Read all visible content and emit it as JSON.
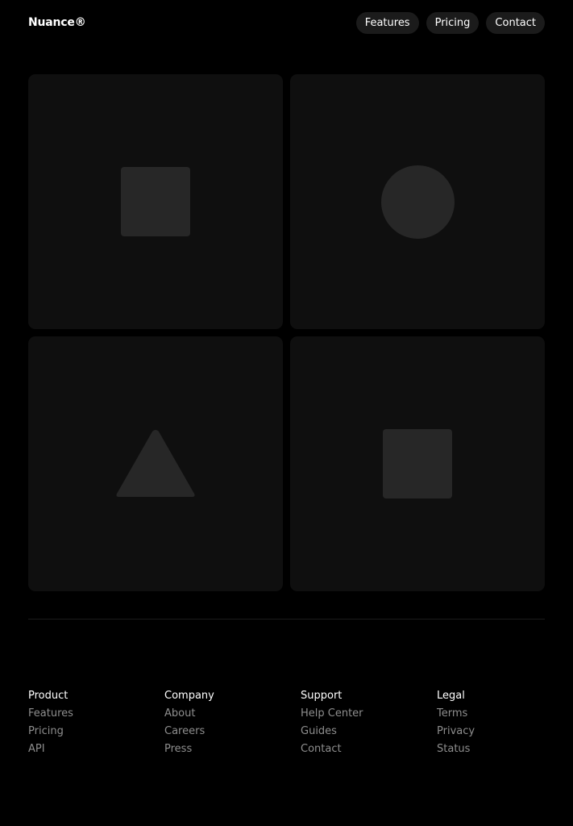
{
  "header": {
    "logo": "Nuance®",
    "nav": [
      {
        "label": "Features"
      },
      {
        "label": "Pricing"
      },
      {
        "label": "Contact"
      }
    ]
  },
  "tiles": [
    {
      "shape": "square-icon"
    },
    {
      "shape": "circle-icon"
    },
    {
      "shape": "triangle-icon"
    },
    {
      "shape": "square-icon"
    }
  ],
  "footer": {
    "columns": [
      {
        "heading": "Product",
        "links": [
          "Features",
          "Pricing",
          "API"
        ]
      },
      {
        "heading": "Company",
        "links": [
          "About",
          "Careers",
          "Press"
        ]
      },
      {
        "heading": "Support",
        "links": [
          "Help Center",
          "Guides",
          "Contact"
        ]
      },
      {
        "heading": "Legal",
        "links": [
          "Terms",
          "Privacy",
          "Status"
        ]
      }
    ]
  },
  "colors": {
    "background": "#000000",
    "tile": "#0f0f0f",
    "shape": "#272727",
    "pill": "#1b1b1b",
    "muted_text": "#8e8e8e"
  }
}
